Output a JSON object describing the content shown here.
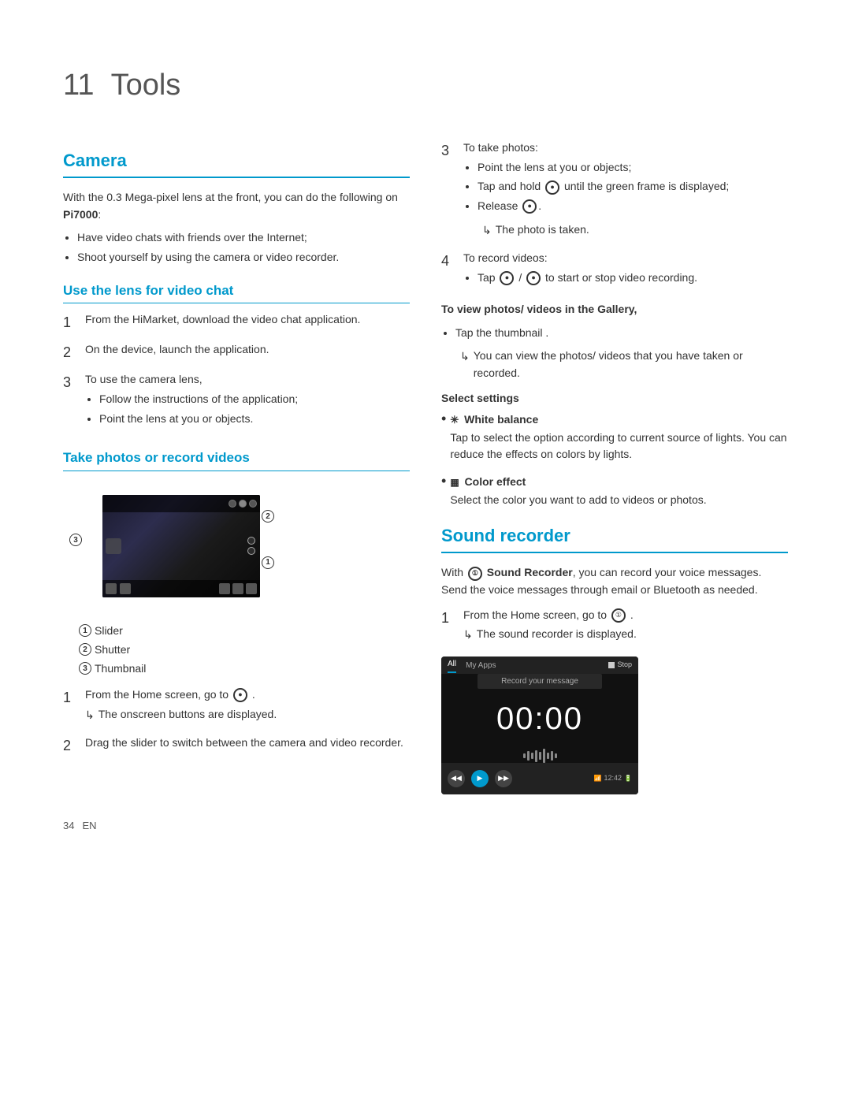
{
  "page": {
    "chapter_num": "11",
    "chapter_title": "Tools",
    "page_number": "34",
    "page_lang": "EN"
  },
  "left": {
    "camera_section": {
      "title": "Camera",
      "intro": "With the 0.3 Mega-pixel lens at the front, you can do the following on ",
      "device_name": "Pi7000",
      "intro_suffix": ":",
      "bullets": [
        "Have video chats with friends over the Internet;",
        "Shoot yourself by using the camera or video recorder."
      ]
    },
    "video_chat": {
      "title": "Use the lens for video chat",
      "steps": [
        {
          "num": "1",
          "text": "From the HiMarket, download the video chat application."
        },
        {
          "num": "2",
          "text": "On the device, launch the application."
        },
        {
          "num": "3",
          "text": "To use the camera lens,",
          "bullets": [
            "Follow the instructions of the application;",
            "Point the lens at you or objects."
          ]
        }
      ]
    },
    "take_photos": {
      "title": "Take photos or record videos",
      "legend": [
        {
          "num": "1",
          "label": "Slider"
        },
        {
          "num": "2",
          "label": "Shutter"
        },
        {
          "num": "3",
          "label": "Thumbnail"
        }
      ],
      "steps": [
        {
          "num": "1",
          "text": "From the Home screen, go to",
          "icon": "●",
          "suffix": ".",
          "note": "The onscreen buttons are displayed."
        },
        {
          "num": "2",
          "text": "Drag the slider to switch between the camera and video recorder."
        }
      ]
    }
  },
  "right": {
    "take_photos_continued": {
      "steps": [
        {
          "num": "3",
          "text": "To take photos:",
          "bullets": [
            "Point the lens at you or objects;",
            "Tap and hold ● until the green frame is displayed;",
            "Release ●."
          ],
          "note": "The photo is taken."
        },
        {
          "num": "4",
          "text": "To record videos:",
          "bullets": [
            "Tap ● / ● to start or stop video recording."
          ]
        }
      ],
      "view_photos": {
        "title": "To view photos/ videos in the Gallery,",
        "bullets": [
          "Tap the thumbnail ."
        ],
        "note": "You can view the photos/ videos that you have taken or recorded."
      },
      "select_settings": {
        "title": "Select settings",
        "items": [
          {
            "icon": "✳",
            "label": "White balance",
            "desc": "Tap to select the option according to current source of lights. You can reduce the effects on colors by lights."
          },
          {
            "icon": "▦",
            "label": "Color effect",
            "desc": "Select the color you want to add to videos or photos."
          }
        ]
      }
    },
    "sound_recorder": {
      "title": "Sound recorder",
      "intro_prefix": "With ",
      "intro_icon": "①",
      "intro_bold": "Sound Recorder",
      "intro_suffix": ", you can record your voice messages. Send the voice messages through email or Bluetooth as needed.",
      "steps": [
        {
          "num": "1",
          "text": "From the Home screen, go to",
          "icon": "①",
          "suffix": ".",
          "note": "The sound recorder is displayed."
        }
      ],
      "screenshot": {
        "top_bar": {
          "tab_all": "All",
          "tab_my_apps": "My Apps",
          "stop_btn": "Stop"
        },
        "record_label": "Record your message",
        "time": "00:00",
        "time_right": "12:42"
      }
    }
  }
}
